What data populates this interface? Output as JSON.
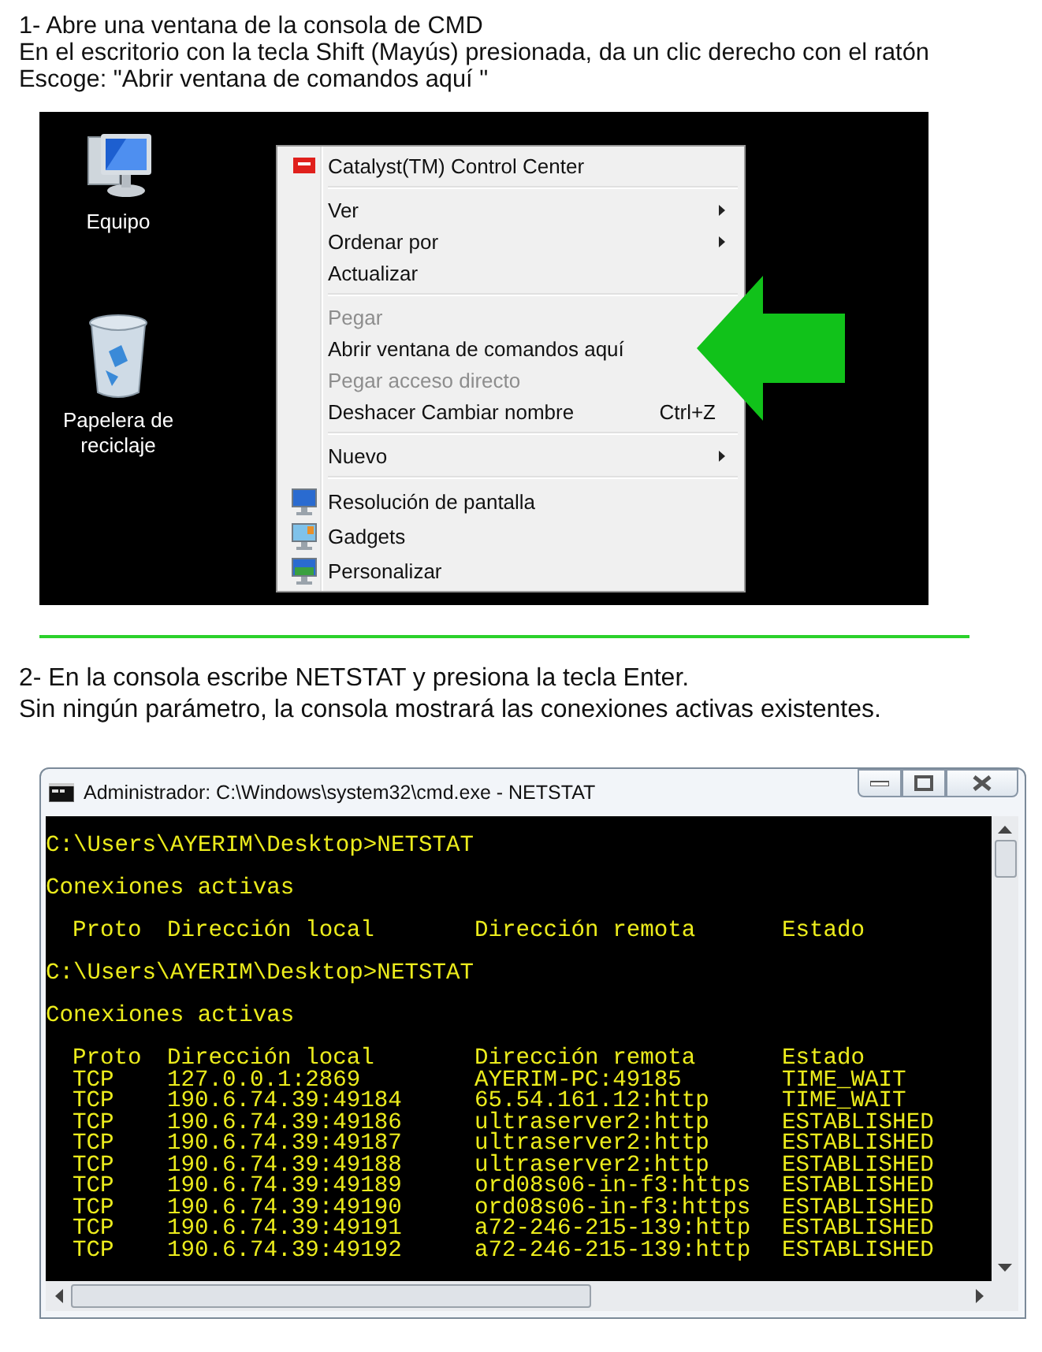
{
  "step_1": {
    "lines": [
      "1- Abre una ventana de la consola de CMD",
      "En el escritorio con la tecla Shift (Mayús) presionada, da un clic derecho con el ratón",
      "Escoge: \"Abrir ventana de comandos aquí \""
    ]
  },
  "desktop": {
    "icons": [
      {
        "kind": "computer",
        "label": "Equipo"
      },
      {
        "kind": "recycle-bin",
        "label": "Papelera de reciclaje"
      }
    ],
    "context_menu": {
      "groups": [
        [
          {
            "label": "Catalyst(TM) Control Center",
            "kind": "vendor",
            "disabled": false,
            "submenu": false
          }
        ],
        [
          {
            "label": "Ver",
            "kind": "plain",
            "disabled": false,
            "submenu": true
          },
          {
            "label": "Ordenar por",
            "kind": "plain",
            "disabled": false,
            "submenu": true
          },
          {
            "label": "Actualizar",
            "kind": "plain",
            "disabled": false,
            "submenu": false
          }
        ],
        [
          {
            "label": "Pegar",
            "kind": "plain",
            "disabled": true,
            "submenu": false
          },
          {
            "label": "Abrir ventana de comandos aquí",
            "kind": "plain",
            "disabled": false,
            "submenu": false
          },
          {
            "label": "Pegar acceso directo",
            "kind": "plain",
            "disabled": true,
            "submenu": false
          },
          {
            "label": "Deshacer Cambiar nombre",
            "kind": "plain",
            "disabled": false,
            "submenu": false,
            "shortcut": "Ctrl+Z"
          }
        ],
        [
          {
            "label": "Nuevo",
            "kind": "plain",
            "disabled": false,
            "submenu": true
          }
        ],
        [
          {
            "label": "Resolución de pantalla",
            "kind": "screen",
            "disabled": false,
            "submenu": false
          },
          {
            "label": "Gadgets",
            "kind": "gadgets",
            "disabled": false,
            "submenu": false
          },
          {
            "label": "Personalizar",
            "kind": "personalize",
            "disabled": false,
            "submenu": false
          }
        ]
      ]
    }
  },
  "step_2": {
    "lines": [
      "2- En la consola escribe NETSTAT y presiona la tecla Enter.",
      "Sin ningún parámetro, la consola mostrará las conexiones activas existentes."
    ]
  },
  "cmd_window": {
    "title": "Administrador: C:\\Windows\\system32\\cmd.exe - NETSTAT",
    "console": [
      {
        "kind": "line",
        "text": "C:\\Users\\AYERIM\\Desktop>NETSTAT"
      },
      {
        "kind": "line",
        "text": "Conexiones activas"
      },
      {
        "kind": "table",
        "columns": [
          "Proto",
          "Dirección local",
          "Dirección remota",
          "Estado"
        ]
      },
      {
        "kind": "line",
        "text": "C:\\Users\\AYERIM\\Desktop>NETSTAT"
      },
      {
        "kind": "line",
        "text": "Conexiones activas"
      },
      {
        "kind": "table",
        "columns": [
          "Proto",
          "Dirección local",
          "Dirección remota",
          "Estado"
        ],
        "rows": [
          [
            "TCP",
            "127.0.0.1:2869",
            "AYERIM-PC:49185",
            "TIME_WAIT"
          ],
          [
            "TCP",
            "190.6.74.39:49184",
            "65.54.161.12:http",
            "TIME_WAIT"
          ],
          [
            "TCP",
            "190.6.74.39:49186",
            "ultraserver2:http",
            "ESTABLISHED"
          ],
          [
            "TCP",
            "190.6.74.39:49187",
            "ultraserver2:http",
            "ESTABLISHED"
          ],
          [
            "TCP",
            "190.6.74.39:49188",
            "ultraserver2:http",
            "ESTABLISHED"
          ],
          [
            "TCP",
            "190.6.74.39:49189",
            "ord08s06-in-f3:https",
            "ESTABLISHED"
          ],
          [
            "TCP",
            "190.6.74.39:49190",
            "ord08s06-in-f3:https",
            "ESTABLISHED"
          ],
          [
            "TCP",
            "190.6.74.39:49191",
            "a72-246-215-139:http",
            "ESTABLISHED"
          ],
          [
            "TCP",
            "190.6.74.39:49192",
            "a72-246-215-139:http",
            "ESTABLISHED"
          ]
        ]
      }
    ]
  }
}
